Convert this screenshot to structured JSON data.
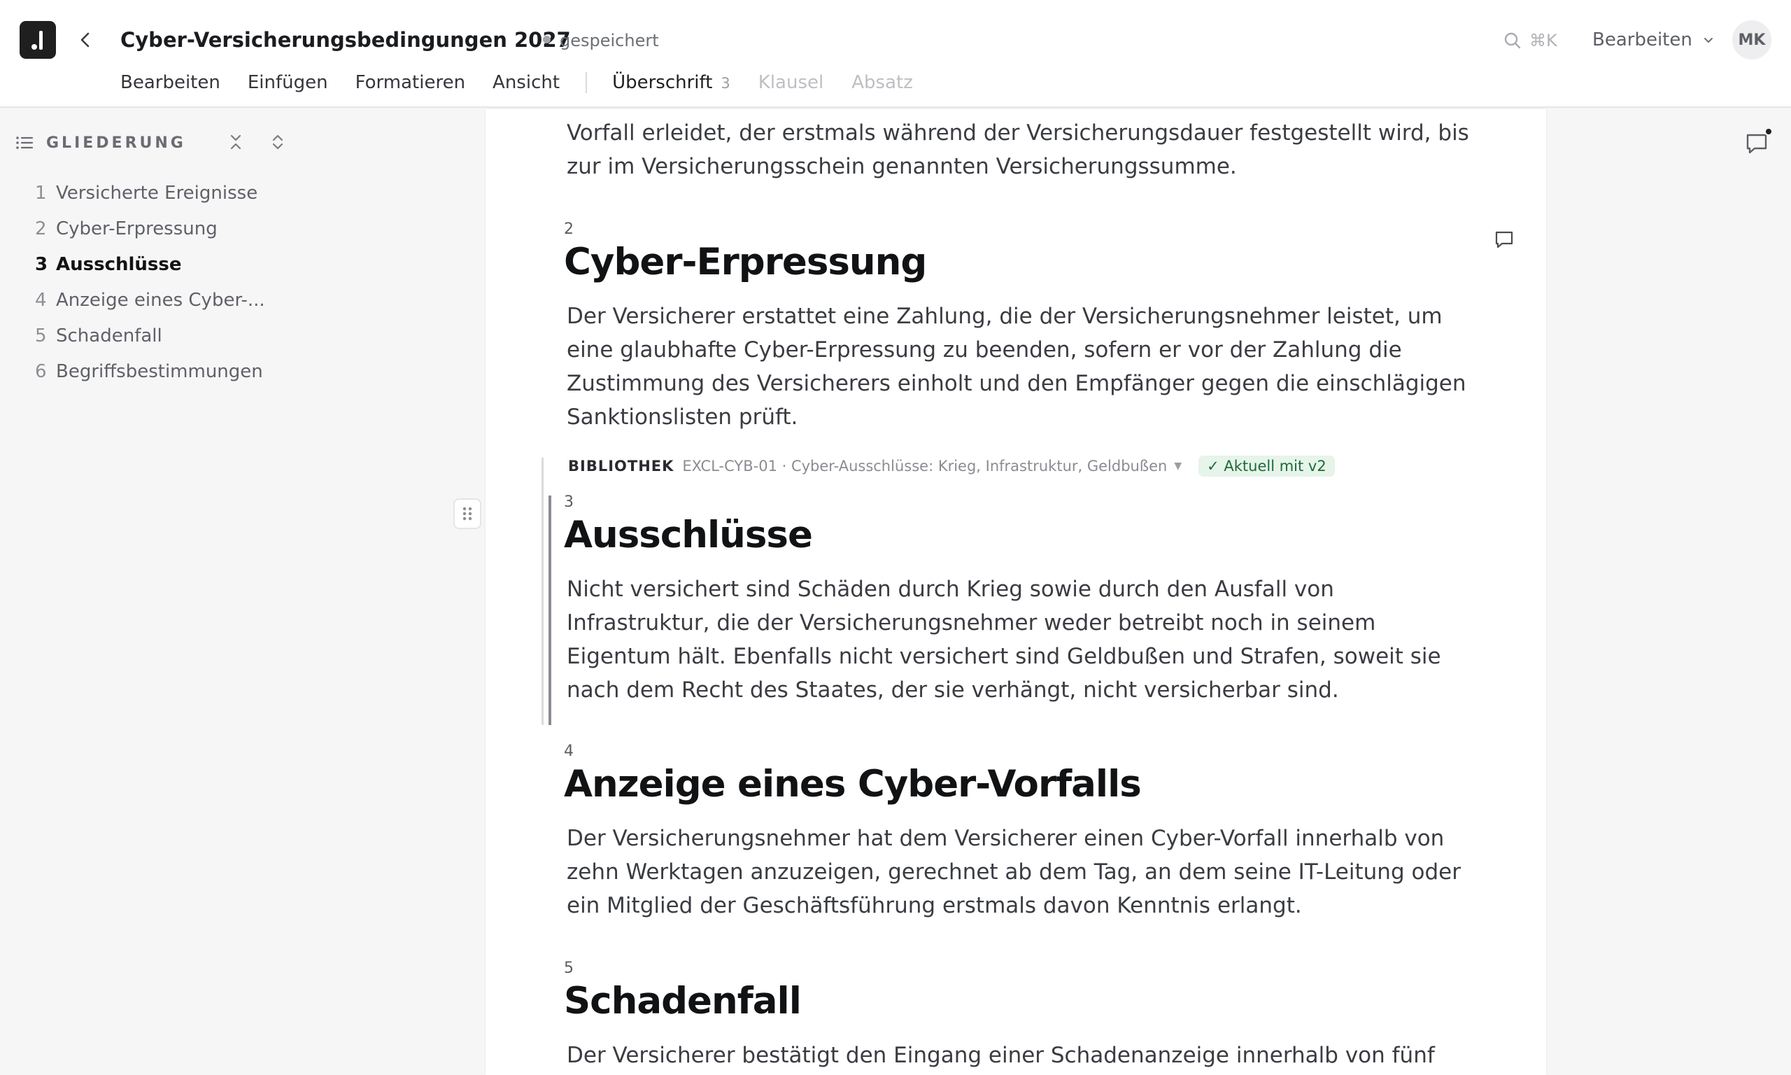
{
  "header": {
    "title": "Cyber-Versicherungsbedingungen 2027",
    "save_status": "gespeichert",
    "search_shortcut": "⌘K",
    "mode_label": "Bearbeiten",
    "avatar_initials": "MK"
  },
  "menu": {
    "items": [
      "Bearbeiten",
      "Einfügen",
      "Formatieren",
      "Ansicht"
    ],
    "context": [
      {
        "label": "Überschrift",
        "count": "3",
        "active": true
      },
      {
        "label": "Klausel",
        "active": false
      },
      {
        "label": "Absatz",
        "active": false
      }
    ]
  },
  "sidebar": {
    "title": "GLIEDERUNG",
    "items": [
      {
        "num": "1",
        "label": "Versicherte Ereignisse"
      },
      {
        "num": "2",
        "label": "Cyber-Erpressung"
      },
      {
        "num": "3",
        "label": "Ausschlüsse"
      },
      {
        "num": "4",
        "label": "Anzeige eines Cyber-..."
      },
      {
        "num": "5",
        "label": "Schadenfall"
      },
      {
        "num": "6",
        "label": "Begriffsbestimmungen"
      }
    ]
  },
  "document": {
    "intro_text": "Vorfall erleidet, der erstmals während der Versicherungsdauer festgestellt wird, bis zur im Versicherungsschein genannten Versicherungssumme.",
    "sections": [
      {
        "num": "2",
        "title": "Cyber-Erpressung",
        "text": "Der Versicherer erstattet eine Zahlung, die der Versicherungsnehmer leistet, um eine glaubhafte Cyber-Erpressung zu beenden, sofern er vor der Zahlung die Zustimmung des Versicherers einholt und den Empfänger gegen die einschlägigen Sanktionslisten prüft."
      },
      {
        "num": "3",
        "title": "Ausschlüsse",
        "text": "Nicht versichert sind Schäden durch Krieg sowie durch den Ausfall von Infrastruktur, die der Versicherungsnehmer weder betreibt noch in seinem Eigentum hält. Ebenfalls nicht versichert sind Geldbußen und Strafen, soweit sie nach dem Recht des Staates, der sie verhängt, nicht versicherbar sind."
      },
      {
        "num": "4",
        "title": "Anzeige eines Cyber-Vorfalls",
        "text": "Der Versicherungsnehmer hat dem Versicherer einen Cyber-Vorfall innerhalb von zehn Werktagen anzuzeigen, gerechnet ab dem Tag, an dem seine IT-Leitung oder ein Mitglied der Geschäftsführung erstmals davon Kenntnis erlangt."
      },
      {
        "num": "5",
        "title": "Schadenfall",
        "text": "Der Versicherer bestätigt den Eingang einer Schadenanzeige innerhalb von fünf"
      }
    ],
    "library": {
      "label": "BIBLIOTHEK",
      "reference": "EXCL-CYB-01 · Cyber-Ausschlüsse: Krieg, Infrastruktur, Geldbußen",
      "status": "✓  Aktuell mit v2"
    }
  },
  "icons": [
    "back-arrow-icon",
    "search-icon",
    "chevron-down-icon",
    "list-icon",
    "collapse-all-icon",
    "expand-all-icon",
    "comment-icon",
    "drag-handle-icon"
  ],
  "colors": {
    "accent_dark": "#1f1f1f",
    "badge_bg": "#e6f4ea",
    "badge_text": "#1d6b3a"
  }
}
